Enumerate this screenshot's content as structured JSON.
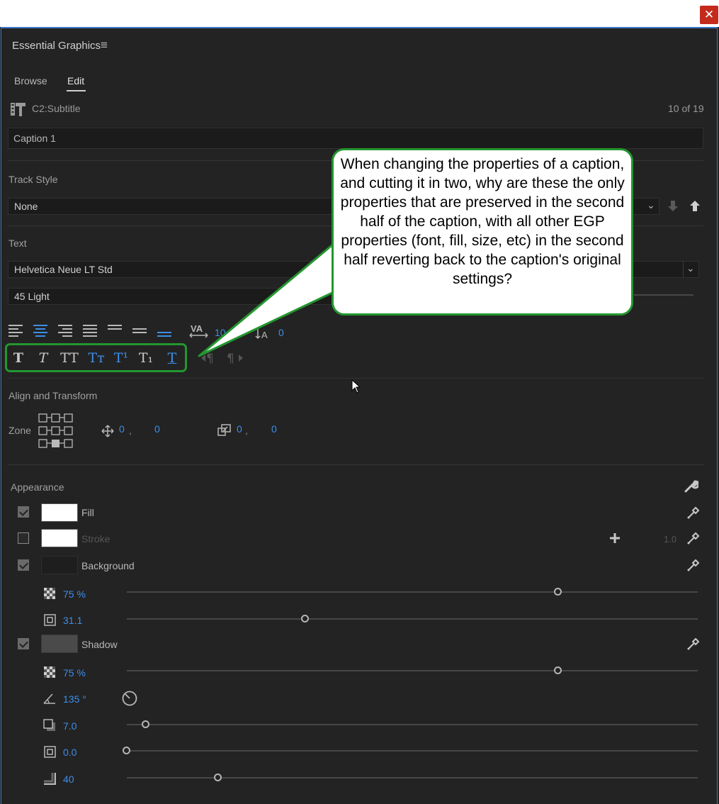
{
  "window": {
    "close_glyph": "✕"
  },
  "panel": {
    "title": "Essential Graphics",
    "menu_glyph": "≡",
    "tabs": [
      {
        "label": "Browse",
        "active": false
      },
      {
        "label": "Edit",
        "active": true
      }
    ],
    "layer_name": "C2:Subtitle",
    "counter": "10 of 19",
    "caption_text": "Caption 1"
  },
  "track_style": {
    "heading": "Track Style",
    "value": "None"
  },
  "text": {
    "heading": "Text",
    "font": "Helvetica Neue LT Std",
    "weight": "45 Light",
    "tracking": "10",
    "leading": "0",
    "style_buttons": [
      {
        "name": "faux-bold",
        "glyph": "T",
        "active": false
      },
      {
        "name": "faux-italic",
        "glyph": "T",
        "active": false
      },
      {
        "name": "all-caps",
        "glyph": "TT",
        "active": false
      },
      {
        "name": "small-caps",
        "glyph": "Tт",
        "active": true
      },
      {
        "name": "superscript",
        "glyph": "T¹",
        "active": true
      },
      {
        "name": "subscript",
        "glyph": "T₁",
        "active": false
      },
      {
        "name": "underline",
        "glyph": "T",
        "active": true
      }
    ]
  },
  "align_transform": {
    "heading": "Align and Transform",
    "zone_label": "Zone",
    "position_x": "0",
    "position_sep": ",",
    "position_y": "0",
    "scale_x": "0",
    "scale_sep": ",",
    "scale_y": "0"
  },
  "appearance": {
    "heading": "Appearance",
    "fill_label": "Fill",
    "stroke_label": "Stroke",
    "stroke_width": "1.0",
    "background_label": "Background",
    "bg_opacity": "75 %",
    "bg_opacity_frac": 0.75,
    "bg_roundness": "31.1",
    "bg_roundness_frac": 0.31,
    "shadow_label": "Shadow",
    "shadow_opacity": "75 %",
    "shadow_opacity_frac": 0.75,
    "shadow_angle": "135 °",
    "shadow_distance": "7.0",
    "shadow_distance_frac": 0.03,
    "shadow_size": "0.0",
    "shadow_size_frac": 0.0,
    "shadow_blur": "40",
    "shadow_blur_frac": 0.16,
    "colors": {
      "fill": "#ffffff",
      "stroke": "#ffffff",
      "background": "#1e1e1e",
      "shadow": "#4a4a4a"
    }
  },
  "callout": {
    "text": "When changing the properties of a caption, and cutting it in two, why are these the only properties that are preserved in the second half of the caption, with all other EGP properties (font, fill, size, etc) in the second half reverting back to the caption's original settings?",
    "border_color": "#23962f"
  }
}
